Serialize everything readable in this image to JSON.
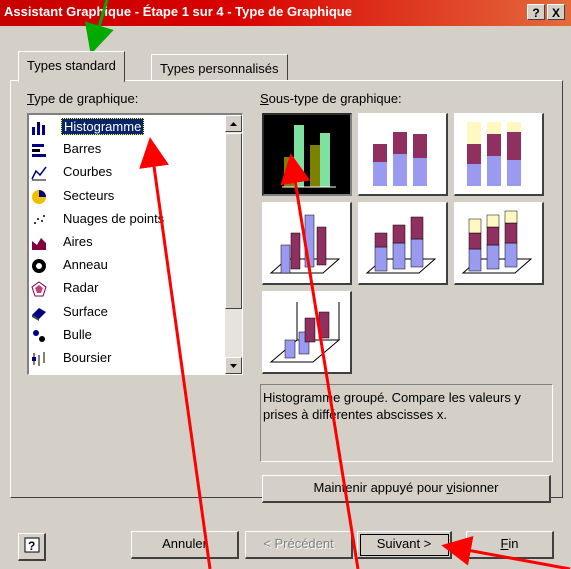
{
  "window": {
    "title": "Assistant Graphique - Étape 1 sur 4 - Type de Graphique",
    "help_btn": "?",
    "close_btn": "X"
  },
  "tabs": [
    {
      "label": "Types standard",
      "active": true
    },
    {
      "label": "Types personnalisés",
      "active": false
    }
  ],
  "chart_type": {
    "label": "Type de graphique:",
    "items": [
      {
        "label": "Histogramme",
        "icon": "column-chart-icon",
        "selected": true
      },
      {
        "label": "Barres",
        "icon": "bar-chart-icon"
      },
      {
        "label": "Courbes",
        "icon": "line-chart-icon"
      },
      {
        "label": "Secteurs",
        "icon": "pie-chart-icon"
      },
      {
        "label": "Nuages de points",
        "icon": "scatter-chart-icon"
      },
      {
        "label": "Aires",
        "icon": "area-chart-icon"
      },
      {
        "label": "Anneau",
        "icon": "doughnut-chart-icon"
      },
      {
        "label": "Radar",
        "icon": "radar-chart-icon"
      },
      {
        "label": "Surface",
        "icon": "surface-chart-icon"
      },
      {
        "label": "Bulle",
        "icon": "bubble-chart-icon"
      },
      {
        "label": "Boursier",
        "icon": "stock-chart-icon"
      }
    ]
  },
  "subtype": {
    "label": "Sous-type de graphique:",
    "items": [
      {
        "name": "clustered-column",
        "selected": true
      },
      {
        "name": "stacked-column"
      },
      {
        "name": "100-stacked-column"
      },
      {
        "name": "3d-clustered-column"
      },
      {
        "name": "3d-stacked-column"
      },
      {
        "name": "3d-100-stacked-column"
      },
      {
        "name": "3d-column"
      }
    ],
    "description": "Histogramme groupé. Compare les valeurs y prises à différentes abscisses x."
  },
  "buttons": {
    "preview": "Maintenir appuyé pour visionner",
    "help": "?",
    "cancel": "Annuler",
    "previous": "< Précédent",
    "next": "Suivant >",
    "finish": "Fin"
  },
  "colors": {
    "title_bar": "#c80000",
    "selection": "#0a246a",
    "dialog": "#d4d0c8",
    "annotation_arrow_red": "#ff0000",
    "annotation_arrow_green": "#00aa00"
  }
}
